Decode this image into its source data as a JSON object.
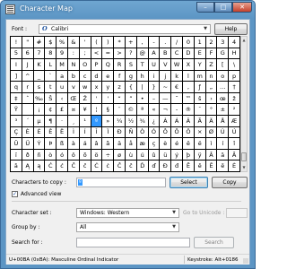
{
  "window": {
    "title": "Character Map",
    "buttons": {
      "minimize": "–",
      "maximize": "□",
      "close": "✕"
    }
  },
  "font": {
    "label": "Font :",
    "selected": "Calibri",
    "icon": "opentype-o-icon",
    "help_label": "Help"
  },
  "grid": {
    "rows": [
      [
        "!",
        "\"",
        "#",
        "$",
        "%",
        "&",
        "'",
        "(",
        ")",
        "*",
        "+",
        ",",
        "-",
        ".",
        "/",
        "0",
        "1",
        "2",
        "3",
        "4"
      ],
      [
        "5",
        "6",
        "7",
        "8",
        "9",
        ":",
        ";",
        "<",
        "=",
        ">",
        "?",
        "@",
        "A",
        "B",
        "C",
        "D",
        "E",
        "F",
        "G",
        "H"
      ],
      [
        "I",
        "J",
        "K",
        "L",
        "M",
        "N",
        "O",
        "P",
        "Q",
        "R",
        "S",
        "T",
        "U",
        "V",
        "W",
        "X",
        "Y",
        "Z",
        "[",
        "\\"
      ],
      [
        "]",
        "^",
        "_",
        "`",
        "a",
        "b",
        "c",
        "d",
        "e",
        "f",
        "g",
        "h",
        "i",
        "j",
        "k",
        "l",
        "m",
        "n",
        "o",
        "p"
      ],
      [
        "q",
        "r",
        "s",
        "t",
        "u",
        "v",
        "w",
        "x",
        "y",
        "z",
        "{",
        "|",
        "}",
        "~",
        "€",
        "‚",
        "ƒ",
        "„",
        "…",
        "†"
      ],
      [
        "‡",
        "ˆ",
        "‰",
        "Š",
        "‹",
        "Œ",
        "Ž",
        "'",
        "'",
        "“",
        "”",
        "•",
        "–",
        "—",
        "˜",
        "™",
        "š",
        "›",
        "œ",
        "ž"
      ],
      [
        "Ÿ",
        " ",
        "¡",
        "¢",
        "£",
        "¤",
        "¥",
        "¦",
        "§",
        "¨",
        "©",
        "ª",
        "«",
        "¬",
        "-",
        "®",
        "¯",
        "°",
        "±",
        "²"
      ],
      [
        "³",
        "´",
        "µ",
        "¶",
        "·",
        "¸",
        "¹",
        "º",
        "»",
        "¼",
        "½",
        "¾",
        "¿",
        "À",
        "Á",
        "Â",
        "Ã",
        "Ä",
        "Å",
        "Æ"
      ],
      [
        "Ç",
        "È",
        "É",
        "Ê",
        "Ë",
        "Ì",
        "Í",
        "Î",
        "Ï",
        "Ð",
        "Ñ",
        "Ò",
        "Ó",
        "Ô",
        "Õ",
        "Ö",
        "×",
        "Ø",
        "Ù",
        "Ú"
      ],
      [
        "Û",
        "Ü",
        "Ý",
        "Þ",
        "ß",
        "à",
        "á",
        "â",
        "ã",
        "ä",
        "å",
        "æ",
        "ç",
        "è",
        "é",
        "ê",
        "ë",
        "ì",
        "í",
        "î"
      ],
      [
        "ï",
        "ð",
        "ñ",
        "ò",
        "ó",
        "ô",
        "õ",
        "ö",
        "÷",
        "ø",
        "ù",
        "ú",
        "û",
        "ü",
        "ý",
        "þ",
        "ÿ",
        "Ā",
        "ā",
        "Ă"
      ],
      [
        "ă",
        "Ą",
        "ą",
        "Ć",
        "ć",
        "Ĉ",
        "ĉ",
        "Ċ",
        "ċ",
        "Č",
        "č",
        "Ď",
        "ď",
        "Đ",
        "đ",
        "Ē",
        "ē",
        "Ĕ",
        "ĕ",
        "Ė"
      ]
    ],
    "selected_char": "º"
  },
  "copy": {
    "label": "Characters to copy :",
    "value": "º",
    "select_label": "Select",
    "copy_label": "Copy"
  },
  "advanced": {
    "label": "Advanced view",
    "checked": "✓"
  },
  "charset": {
    "label": "Character set :",
    "selected": "Windows: Western",
    "goto_label": "Go to Unicode :",
    "goto_value": ""
  },
  "groupby": {
    "label": "Group by :",
    "selected": "All"
  },
  "search": {
    "label": "Search for :",
    "value": "",
    "button_label": "Search"
  },
  "status": {
    "description": "U+00BA (0xBA): Masculine Ordinal Indicator",
    "keystroke": "Keystroke: Alt+0186"
  }
}
